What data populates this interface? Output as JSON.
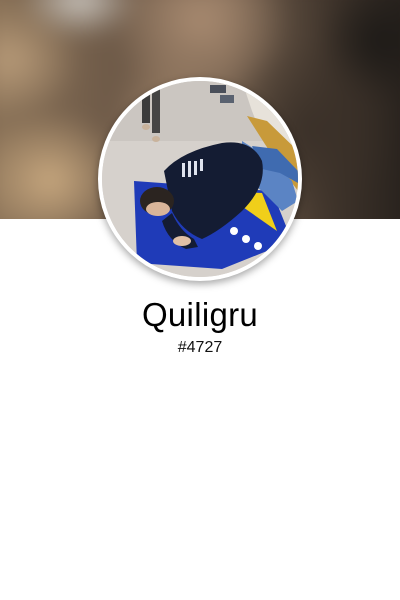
{
  "profile": {
    "username": "Quiligru",
    "discriminator": "#4727",
    "avatar_icon": "user-avatar-photo",
    "cover_icon": "profile-cover-photo"
  }
}
